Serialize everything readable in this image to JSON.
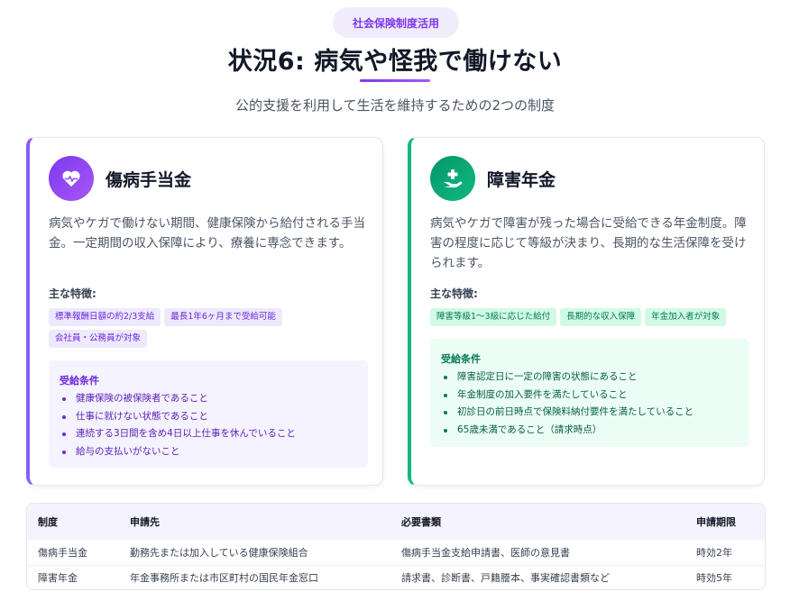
{
  "header": {
    "badge": "社会保険制度活用",
    "title": "状況6: 病気や怪我で働けない",
    "subtitle": "公的支援を利用して生活を維持するための2つの制度"
  },
  "cards": [
    {
      "icon": "heart-pulse-icon",
      "accent": "#8b5cf6",
      "title": "傷病手当金",
      "description": "病気やケガで働けない期間、健康保険から給付される手当金。一定期間の収入保障により、療養に専念できます。",
      "features_label": "主な特徴:",
      "tags": [
        "標準報酬日額の約2/3支給",
        "最長1年6ヶ月まで受給可能",
        "会社員・公務員が対象"
      ],
      "conditions_title": "受給条件",
      "conditions": [
        "健康保険の被保険者であること",
        "仕事に就けない状態であること",
        "連続する3日間を含め4日以上仕事を休んでいること",
        "給与の支払いがないこと"
      ]
    },
    {
      "icon": "hand-holding-medical-icon",
      "accent": "#10b981",
      "title": "障害年金",
      "description": "病気やケガで障害が残った場合に受給できる年金制度。障害の程度に応じて等級が決まり、長期的な生活保障を受けられます。",
      "features_label": "主な特徴:",
      "tags": [
        "障害等級1〜3級に応じた給付",
        "長期的な収入保障",
        "年金加入者が対象"
      ],
      "conditions_title": "受給条件",
      "conditions": [
        "障害認定日に一定の障害の状態にあること",
        "年金制度の加入要件を満たしていること",
        "初診日の前日時点で保険料納付要件を満たしていること",
        "65歳未満であること（請求時点）"
      ]
    }
  ],
  "table": {
    "headers": [
      "制度",
      "申請先",
      "必要書類",
      "申請期限"
    ],
    "rows": [
      [
        "傷病手当金",
        "勤務先または加入している健康保険組合",
        "傷病手当金支給申請書、医師の意見書",
        "時効2年"
      ],
      [
        "障害年金",
        "年金事務所または市区町村の国民年金窓口",
        "請求書、診断書、戸籍謄本、事実確認書類など",
        "時効5年"
      ]
    ]
  }
}
